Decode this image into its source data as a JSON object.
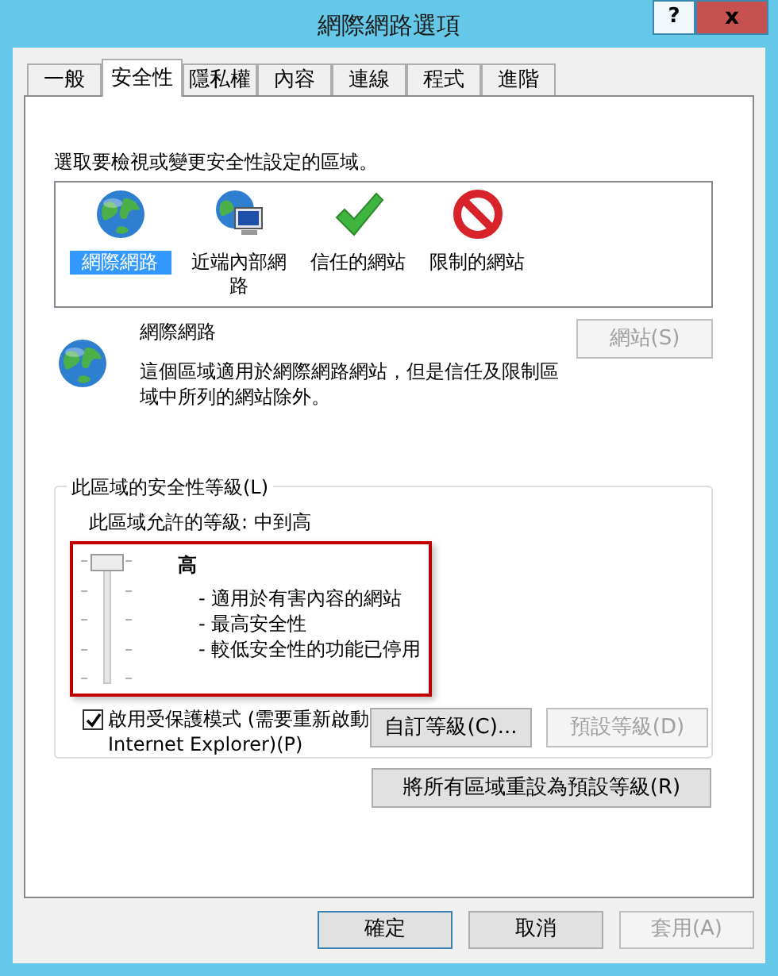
{
  "window": {
    "title": "網際網路選項",
    "help_button": "?",
    "close_button": "x"
  },
  "tabs": [
    {
      "label": "一般",
      "selected": false
    },
    {
      "label": "安全性",
      "selected": true
    },
    {
      "label": "隱私權",
      "selected": false
    },
    {
      "label": "內容",
      "selected": false
    },
    {
      "label": "連線",
      "selected": false
    },
    {
      "label": "程式",
      "selected": false
    },
    {
      "label": "進階",
      "selected": false
    }
  ],
  "zone_prompt": "選取要檢視或變更安全性設定的區域。",
  "zones": [
    {
      "kind": "internet",
      "label": "網際網路",
      "selected": true
    },
    {
      "kind": "intranet",
      "label": "近端內部網路",
      "selected": false
    },
    {
      "kind": "trusted",
      "label": "信任的網站",
      "selected": false
    },
    {
      "kind": "restricted",
      "label": "限制的網站",
      "selected": false
    }
  ],
  "zone_info": {
    "name": "網際網路",
    "description": "這個區域適用於網際網路網站，但是信任及限制區域中所列的網站除外。",
    "sites_button": {
      "label": "網站(S)",
      "disabled": true
    }
  },
  "security_level": {
    "legend": "此區域的安全性等級(L)",
    "allowed": "此區域允許的等級: 中到高",
    "slider": {
      "level": 1
    },
    "level_name": "高",
    "bullets": [
      "- 適用於有害內容的網站",
      "- 最高安全性",
      "- 較低安全性的功能已停用"
    ],
    "protected_mode": {
      "label": "啟用受保護模式 (需要重新啟動 Internet Explorer)(P)",
      "checked": true
    },
    "buttons": [
      {
        "label": "自訂等級(C)...",
        "disabled": false
      },
      {
        "label": "預設等級(D)",
        "disabled": true
      }
    ]
  },
  "reset_button": {
    "label": "將所有區域重設為預設等級(R)",
    "disabled": false
  },
  "dialog_buttons": [
    {
      "label": "確定",
      "disabled": false,
      "default": true
    },
    {
      "label": "取消",
      "disabled": false,
      "default": false
    },
    {
      "label": "套用(A)",
      "disabled": true,
      "default": false
    }
  ]
}
